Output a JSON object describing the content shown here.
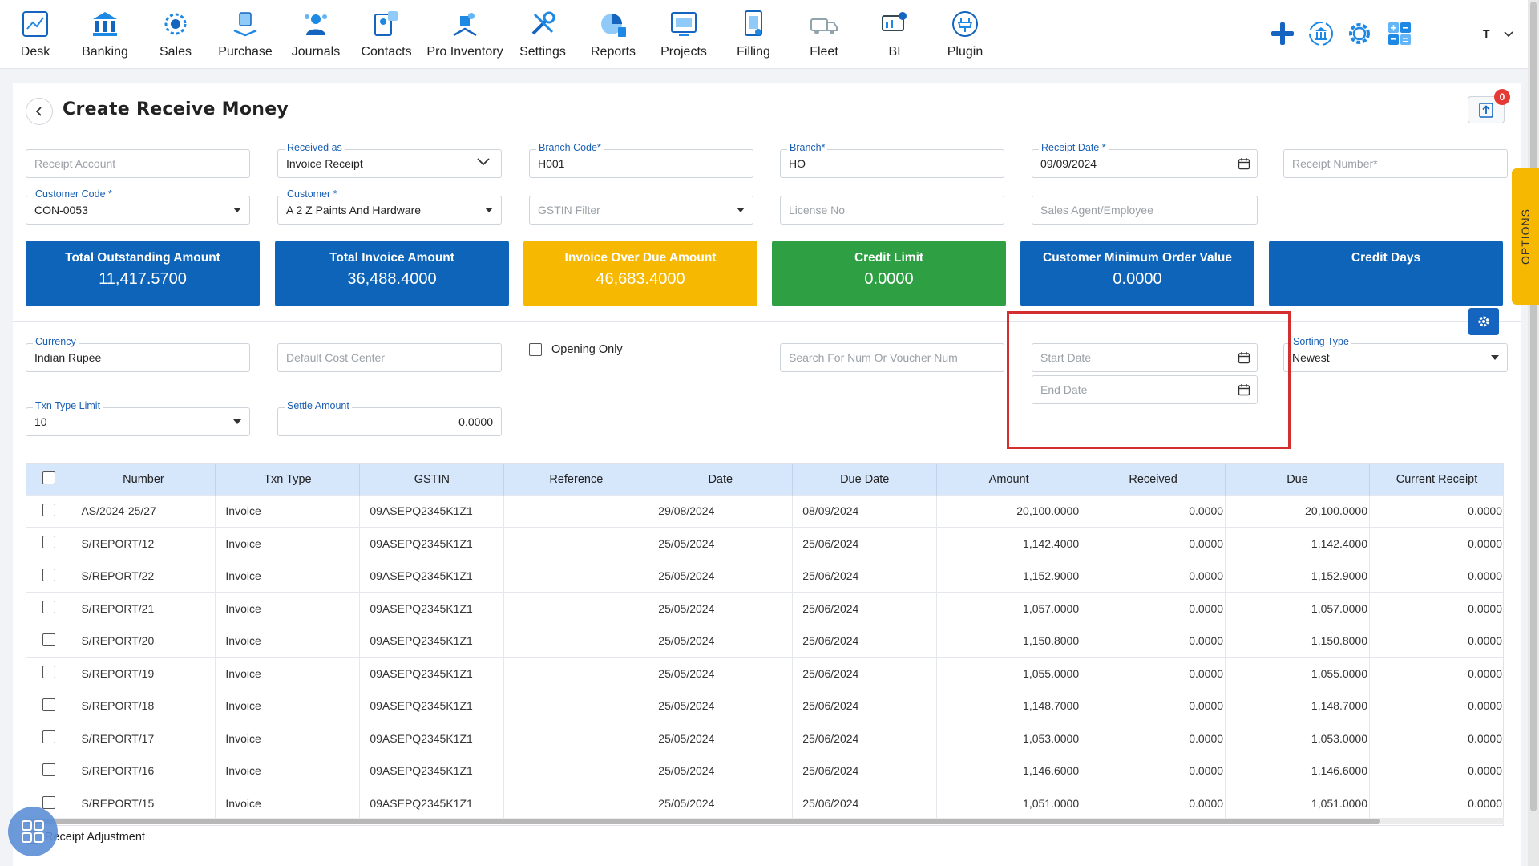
{
  "nav": {
    "items": [
      {
        "label": "Desk",
        "icon": "desk-icon"
      },
      {
        "label": "Banking",
        "icon": "bank-icon"
      },
      {
        "label": "Sales",
        "icon": "sales-icon"
      },
      {
        "label": "Purchase",
        "icon": "purchase-icon"
      },
      {
        "label": "Journals",
        "icon": "journals-icon"
      },
      {
        "label": "Contacts",
        "icon": "contacts-icon"
      },
      {
        "label": "Pro Inventory",
        "icon": "inventory-icon"
      },
      {
        "label": "Settings",
        "icon": "settings-icon"
      },
      {
        "label": "Reports",
        "icon": "reports-icon"
      },
      {
        "label": "Projects",
        "icon": "projects-icon"
      },
      {
        "label": "Filling",
        "icon": "filling-icon"
      },
      {
        "label": "Fleet",
        "icon": "fleet-icon"
      },
      {
        "label": "BI",
        "icon": "bi-icon"
      },
      {
        "label": "Plugin",
        "icon": "plugin-icon"
      }
    ],
    "user_initial": "T"
  },
  "header": {
    "title": "Create Receive Money",
    "notification_count": "0"
  },
  "form": {
    "receipt_account": {
      "placeholder": "Receipt Account"
    },
    "received_as": {
      "label": "Received as",
      "value": "Invoice Receipt"
    },
    "branch_code": {
      "label": "Branch Code*",
      "value": "H001"
    },
    "branch": {
      "label": "Branch*",
      "value": "HO"
    },
    "receipt_date": {
      "label": "Receipt Date *",
      "value": "09/09/2024"
    },
    "receipt_number": {
      "placeholder": "Receipt Number*"
    },
    "customer_code": {
      "label": "Customer Code *",
      "value": "CON-0053"
    },
    "customer": {
      "label": "Customer *",
      "value": "A 2 Z Paints And Hardware"
    },
    "gstin_filter": {
      "placeholder": "GSTIN Filter"
    },
    "license_no": {
      "placeholder": "License No"
    },
    "sales_agent": {
      "placeholder": "Sales Agent/Employee"
    },
    "currency": {
      "label": "Currency",
      "value": "Indian Rupee"
    },
    "default_cost_center": {
      "placeholder": "Default Cost Center"
    },
    "opening_only": {
      "label": "Opening Only"
    },
    "search_num": {
      "placeholder": "Search For Num Or Voucher Num"
    },
    "start_date": {
      "placeholder": "Start Date"
    },
    "end_date": {
      "placeholder": "End Date"
    },
    "sorting_type": {
      "label": "Sorting Type",
      "value": "Newest"
    },
    "txn_type_limit": {
      "label": "Txn Type Limit",
      "value": "10"
    },
    "settle_amount": {
      "label": "Settle Amount",
      "value": "0.0000"
    }
  },
  "kpis": [
    {
      "label": "Total Outstanding Amount",
      "value": "11,417.5700",
      "color": "#0d64b8"
    },
    {
      "label": "Total Invoice Amount",
      "value": "36,488.4000",
      "color": "#0d64b8"
    },
    {
      "label": "Invoice Over Due Amount",
      "value": "46,683.4000",
      "color": "#f6b800"
    },
    {
      "label": "Credit Limit",
      "value": "0.0000",
      "color": "#2ea043"
    },
    {
      "label": "Customer Minimum Order Value",
      "value": "0.0000",
      "color": "#0d64b8"
    },
    {
      "label": "Credit Days",
      "value": "",
      "color": "#0d64b8"
    }
  ],
  "options_tab": "OPTIONS",
  "table": {
    "headers": [
      "Number",
      "Txn Type",
      "GSTIN",
      "Reference",
      "Date",
      "Due Date",
      "Amount",
      "Received",
      "Due",
      "Current Receipt"
    ],
    "rows": [
      [
        "AS/2024-25/27",
        "Invoice",
        "09ASEPQ2345K1Z1",
        "",
        "29/08/2024",
        "08/09/2024",
        "20,100.0000",
        "0.0000",
        "20,100.0000",
        "0.0000"
      ],
      [
        "S/REPORT/12",
        "Invoice",
        "09ASEPQ2345K1Z1",
        "",
        "25/05/2024",
        "25/06/2024",
        "1,142.4000",
        "0.0000",
        "1,142.4000",
        "0.0000"
      ],
      [
        "S/REPORT/22",
        "Invoice",
        "09ASEPQ2345K1Z1",
        "",
        "25/05/2024",
        "25/06/2024",
        "1,152.9000",
        "0.0000",
        "1,152.9000",
        "0.0000"
      ],
      [
        "S/REPORT/21",
        "Invoice",
        "09ASEPQ2345K1Z1",
        "",
        "25/05/2024",
        "25/06/2024",
        "1,057.0000",
        "0.0000",
        "1,057.0000",
        "0.0000"
      ],
      [
        "S/REPORT/20",
        "Invoice",
        "09ASEPQ2345K1Z1",
        "",
        "25/05/2024",
        "25/06/2024",
        "1,150.8000",
        "0.0000",
        "1,150.8000",
        "0.0000"
      ],
      [
        "S/REPORT/19",
        "Invoice",
        "09ASEPQ2345K1Z1",
        "",
        "25/05/2024",
        "25/06/2024",
        "1,055.0000",
        "0.0000",
        "1,055.0000",
        "0.0000"
      ],
      [
        "S/REPORT/18",
        "Invoice",
        "09ASEPQ2345K1Z1",
        "",
        "25/05/2024",
        "25/06/2024",
        "1,148.7000",
        "0.0000",
        "1,148.7000",
        "0.0000"
      ],
      [
        "S/REPORT/17",
        "Invoice",
        "09ASEPQ2345K1Z1",
        "",
        "25/05/2024",
        "25/06/2024",
        "1,053.0000",
        "0.0000",
        "1,053.0000",
        "0.0000"
      ],
      [
        "S/REPORT/16",
        "Invoice",
        "09ASEPQ2345K1Z1",
        "",
        "25/05/2024",
        "25/06/2024",
        "1,146.6000",
        "0.0000",
        "1,146.6000",
        "0.0000"
      ],
      [
        "S/REPORT/15",
        "Invoice",
        "09ASEPQ2345K1Z1",
        "",
        "25/05/2024",
        "25/06/2024",
        "1,051.0000",
        "0.0000",
        "1,051.0000",
        "0.0000"
      ]
    ]
  },
  "footer": {
    "receipt_adjustment": "Receipt Adjustment"
  }
}
